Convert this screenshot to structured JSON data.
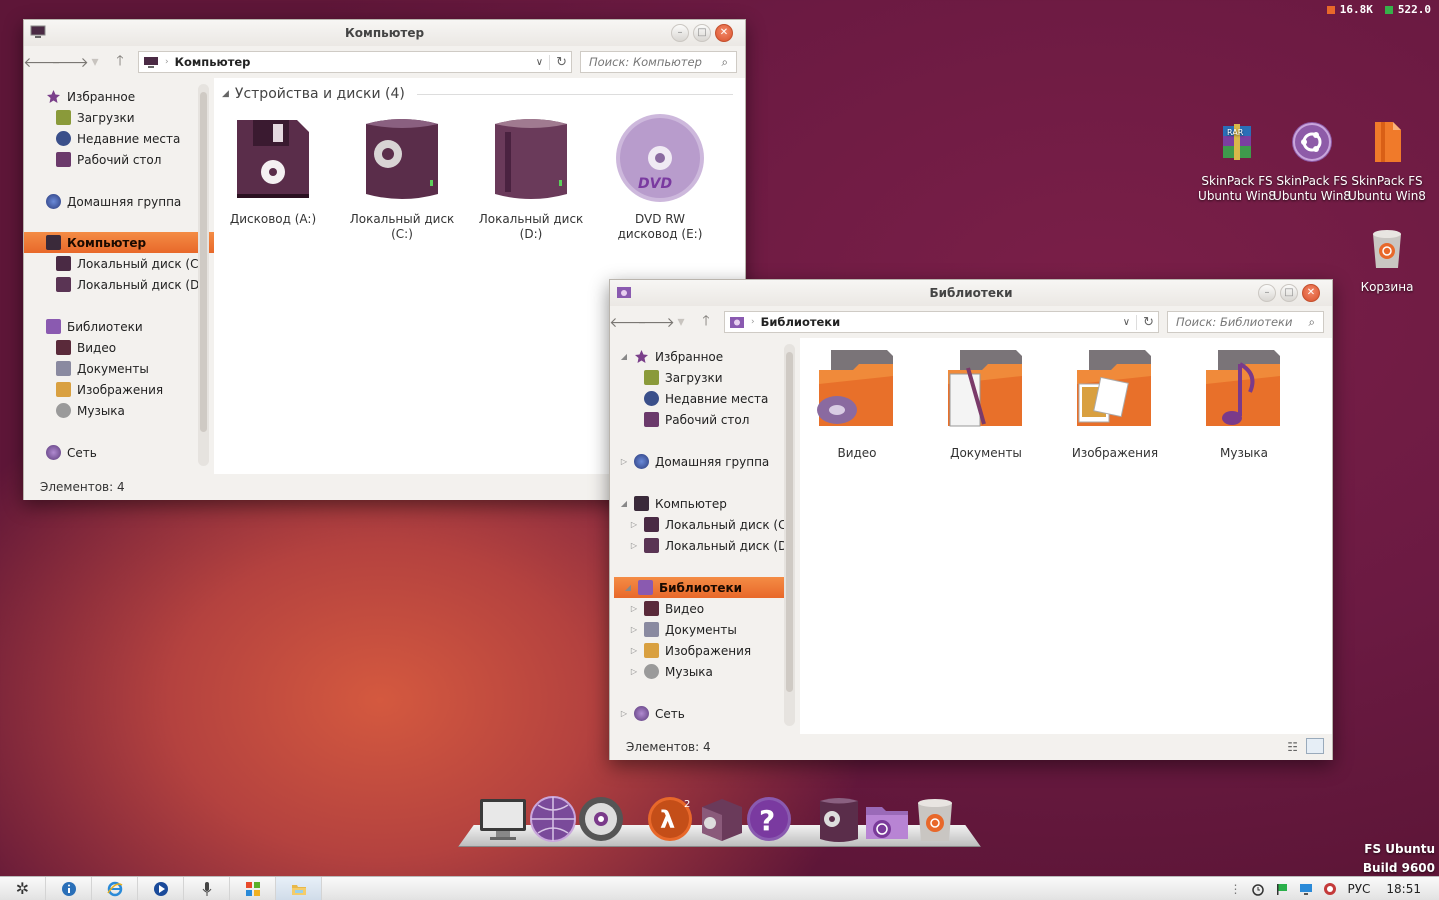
{
  "system_meters": {
    "net": "16.8K",
    "mem": "522.0",
    "net_color": "#e8682a",
    "mem_color": "#36b14a"
  },
  "desktop_icons": [
    {
      "label1": "SkinPack FS",
      "label2": "Ubuntu Win8",
      "icon": "rar-archive-icon"
    },
    {
      "label1": "SkinPack FS",
      "label2": "Ubuntu Win8",
      "icon": "ubuntu-logo-icon"
    },
    {
      "label1": "SkinPack FS",
      "label2": "Ubuntu Win8",
      "icon": "orange-file-icon"
    },
    {
      "label1": "Корзина",
      "label2": "",
      "icon": "recycle-bin-icon"
    }
  ],
  "win_computer": {
    "title": "Компьютер",
    "address": "Компьютер",
    "search_placeholder": "Поиск: Компьютер",
    "group_title": "Устройства и диски (4)",
    "nav": [
      {
        "label": "Избранное"
      },
      {
        "label": "Загрузки"
      },
      {
        "label": "Недавние места"
      },
      {
        "label": "Рабочий стол"
      },
      {
        "label": "Домашняя группа"
      },
      {
        "label": "Компьютер"
      },
      {
        "label": "Локальный диск (C:)"
      },
      {
        "label": "Локальный диск (D:)"
      },
      {
        "label": "Библиотеки"
      },
      {
        "label": "Видео"
      },
      {
        "label": "Документы"
      },
      {
        "label": "Изображения"
      },
      {
        "label": "Музыка"
      },
      {
        "label": "Сеть"
      }
    ],
    "items": [
      {
        "line1": "Дисковод (A:)",
        "line2": "",
        "icon": "floppy-drive-icon"
      },
      {
        "line1": "Локальный диск",
        "line2": "(C:)",
        "icon": "system-disk-icon"
      },
      {
        "line1": "Локальный диск",
        "line2": "(D:)",
        "icon": "hard-disk-icon"
      },
      {
        "line1": "DVD RW",
        "line2": "дисковод (E:)",
        "icon": "dvd-drive-icon"
      }
    ],
    "status": "Элементов: 4"
  },
  "win_libraries": {
    "title": "Библиотеки",
    "address": "Библиотеки",
    "search_placeholder": "Поиск: Библиотеки",
    "nav": [
      {
        "label": "Избранное"
      },
      {
        "label": "Загрузки"
      },
      {
        "label": "Недавние места"
      },
      {
        "label": "Рабочий стол"
      },
      {
        "label": "Домашняя группа"
      },
      {
        "label": "Компьютер"
      },
      {
        "label": "Локальный диск (C:)"
      },
      {
        "label": "Локальный диск (D:)"
      },
      {
        "label": "Библиотеки"
      },
      {
        "label": "Видео"
      },
      {
        "label": "Документы"
      },
      {
        "label": "Изображения"
      },
      {
        "label": "Музыка"
      },
      {
        "label": "Сеть"
      }
    ],
    "items": [
      {
        "label": "Видео",
        "icon": "video-library-folder-icon"
      },
      {
        "label": "Документы",
        "icon": "documents-library-folder-icon"
      },
      {
        "label": "Изображения",
        "icon": "pictures-library-folder-icon"
      },
      {
        "label": "Музыка",
        "icon": "music-library-folder-icon"
      }
    ],
    "status": "Элементов: 4"
  },
  "dock_icons": [
    "monitor-icon",
    "globe-icon",
    "gear-icon",
    "half-life-2-icon",
    "settings-box-icon",
    "help-icon",
    "system-disk-icon",
    "ubuntu-folder-icon",
    "recycle-bin-icon"
  ],
  "build": {
    "line1": "FS Ubuntu",
    "line2": "Build 9600"
  },
  "taskbar": {
    "items": [
      "start-gear-icon",
      "info-icon",
      "internet-explorer-icon",
      "media-player-icon",
      "microphone-icon",
      "windows-store-icon",
      "explorer-icon"
    ],
    "language": "РУС",
    "clock": "18:51"
  }
}
